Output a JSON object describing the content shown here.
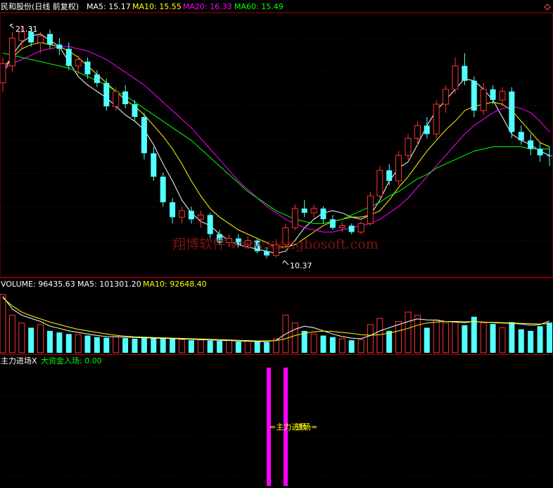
{
  "stock_name": "民和股份(日线 前复权)",
  "corner_icon": "diamond-icon",
  "watermark": "翔博软件 www.xiangbosoft.com",
  "price_panel": {
    "legend": [
      {
        "label": "MA5: 15.17",
        "color": "#ffffff"
      },
      {
        "label": "MA10: 15.55",
        "color": "#ffff00"
      },
      {
        "label": "MA20: 16.33",
        "color": "#ff00ff"
      },
      {
        "label": "MA60: 15.49",
        "color": "#00ff00"
      }
    ],
    "high_marker": "21.31",
    "low_marker": "10.37"
  },
  "volume_panel": {
    "legend": [
      {
        "label": "VOLUME: 96435.63",
        "color": "#ffffff"
      },
      {
        "label": "MA5: 101301.20",
        "color": "#ffffff"
      },
      {
        "label": "MA10: 92648.40",
        "color": "#ffff00"
      }
    ]
  },
  "signal_panel": {
    "legend": [
      {
        "label": "主力进场X",
        "color": "#ffffff"
      },
      {
        "label": "大资金入场: 0.00",
        "color": "#00ff00"
      }
    ],
    "annotations": [
      "=主力进场",
      "进场="
    ]
  },
  "colors": {
    "up": "#ff3232",
    "down": "#54ffff",
    "grid": "#7a0000",
    "border": "#b00000",
    "ma5": "#ffffff",
    "ma10": "#ffff00",
    "ma20": "#ff00ff",
    "ma60": "#00ff00",
    "signal": "#ff00ff",
    "signal_text": "#ffff00"
  },
  "chart_data": [
    {
      "type": "candlestick",
      "title": "民和股份(日线 前复权)",
      "ylim": [
        9.6,
        21.7
      ],
      "series": [
        {
          "name": "MA5",
          "values": [
            19.0,
            19.9,
            20.5,
            20.8,
            20.9,
            20.6,
            20.3,
            19.6,
            18.9,
            18.5,
            18.2,
            17.9,
            17.5,
            17.1,
            16.8,
            16.4,
            15.7,
            14.8,
            14.0,
            13.1,
            12.5,
            12.1,
            11.9,
            11.5,
            11.2,
            11.0,
            10.9,
            10.8,
            10.7,
            10.6,
            10.7,
            11.2,
            11.8,
            12.2,
            12.5,
            12.6,
            12.5,
            12.3,
            12.2,
            12.4,
            13.1,
            14.0,
            14.6,
            14.9,
            15.7,
            16.6,
            17.3,
            17.8,
            18.3,
            18.8,
            18.7,
            18.3,
            17.8,
            17.0,
            16.2,
            15.9,
            15.7,
            15.4,
            15.2
          ]
        },
        {
          "name": "MA10",
          "values": [
            19.3,
            19.8,
            20.2,
            20.4,
            20.5,
            20.4,
            20.3,
            20.1,
            19.8,
            19.4,
            19.0,
            18.6,
            18.2,
            17.8,
            17.5,
            17.1,
            16.6,
            16.1,
            15.5,
            14.8,
            14.0,
            13.3,
            12.7,
            12.3,
            12.0,
            11.7,
            11.5,
            11.3,
            11.1,
            10.9,
            10.9,
            11.0,
            11.3,
            11.6,
            11.9,
            12.1,
            12.2,
            12.3,
            12.3,
            12.4,
            12.6,
            13.1,
            13.7,
            14.2,
            14.8,
            15.4,
            15.9,
            16.4,
            16.8,
            17.3,
            17.5,
            17.6,
            17.7,
            17.6,
            17.3,
            16.8,
            16.3,
            15.8,
            15.6
          ]
        },
        {
          "name": "MA20",
          "values": [
            19.2,
            19.5,
            19.7,
            19.9,
            20.1,
            20.2,
            20.3,
            20.3,
            20.2,
            20.1,
            19.9,
            19.7,
            19.4,
            19.1,
            18.8,
            18.5,
            18.1,
            17.7,
            17.3,
            16.9,
            16.5,
            16.0,
            15.5,
            15.0,
            14.5,
            14.0,
            13.6,
            13.2,
            12.8,
            12.5,
            12.2,
            12.0,
            11.8,
            11.7,
            11.6,
            11.6,
            11.7,
            11.8,
            11.9,
            12.0,
            12.2,
            12.5,
            12.8,
            13.2,
            13.7,
            14.2,
            14.7,
            15.2,
            15.7,
            16.2,
            16.6,
            16.9,
            17.2,
            17.4,
            17.5,
            17.4,
            17.2,
            16.8,
            16.3
          ]
        },
        {
          "name": "MA60",
          "values": [
            20.0,
            19.9,
            19.8,
            19.7,
            19.6,
            19.5,
            19.4,
            19.3,
            19.1,
            18.9,
            18.7,
            18.5,
            18.2,
            18.0,
            17.7,
            17.4,
            17.1,
            16.8,
            16.5,
            16.2,
            15.9,
            15.5,
            15.1,
            14.7,
            14.3,
            13.9,
            13.5,
            13.2,
            12.9,
            12.6,
            12.4,
            12.2,
            12.1,
            12.0,
            12.0,
            12.1,
            12.2,
            12.4,
            12.6,
            12.8,
            13.0,
            13.3,
            13.5,
            13.8,
            14.1,
            14.3,
            14.6,
            14.8,
            15.0,
            15.2,
            15.4,
            15.5,
            15.6,
            15.6,
            15.6,
            15.6,
            15.5,
            15.5,
            15.5
          ]
        }
      ],
      "candles": [
        {
          "o": 18.6,
          "h": 19.8,
          "l": 18.2,
          "c": 19.5
        },
        {
          "o": 19.4,
          "h": 21.0,
          "l": 19.1,
          "c": 20.7
        },
        {
          "o": 20.6,
          "h": 21.3,
          "l": 20.2,
          "c": 21.0
        },
        {
          "o": 21.0,
          "h": 21.2,
          "l": 20.3,
          "c": 20.5
        },
        {
          "o": 20.5,
          "h": 21.0,
          "l": 20.0,
          "c": 20.8
        },
        {
          "o": 20.9,
          "h": 21.1,
          "l": 20.2,
          "c": 20.4
        },
        {
          "o": 20.4,
          "h": 20.7,
          "l": 19.9,
          "c": 20.2
        },
        {
          "o": 20.2,
          "h": 20.5,
          "l": 19.2,
          "c": 19.4
        },
        {
          "o": 19.4,
          "h": 19.9,
          "l": 19.0,
          "c": 19.7
        },
        {
          "o": 19.6,
          "h": 19.8,
          "l": 18.8,
          "c": 19.0
        },
        {
          "o": 19.0,
          "h": 19.2,
          "l": 18.4,
          "c": 18.6
        },
        {
          "o": 18.6,
          "h": 18.8,
          "l": 17.3,
          "c": 17.5
        },
        {
          "o": 17.5,
          "h": 18.4,
          "l": 17.3,
          "c": 18.2
        },
        {
          "o": 18.2,
          "h": 18.5,
          "l": 17.4,
          "c": 17.6
        },
        {
          "o": 17.6,
          "h": 17.8,
          "l": 16.8,
          "c": 17.0
        },
        {
          "o": 17.0,
          "h": 17.2,
          "l": 15.0,
          "c": 15.3
        },
        {
          "o": 15.3,
          "h": 15.6,
          "l": 14.0,
          "c": 14.2
        },
        {
          "o": 14.2,
          "h": 14.4,
          "l": 12.8,
          "c": 13.0
        },
        {
          "o": 13.0,
          "h": 13.2,
          "l": 12.0,
          "c": 12.3
        },
        {
          "o": 12.3,
          "h": 12.8,
          "l": 12.0,
          "c": 12.6
        },
        {
          "o": 12.6,
          "h": 12.8,
          "l": 12.0,
          "c": 12.2
        },
        {
          "o": 12.2,
          "h": 12.6,
          "l": 11.8,
          "c": 12.4
        },
        {
          "o": 12.4,
          "h": 12.5,
          "l": 11.3,
          "c": 11.5
        },
        {
          "o": 11.5,
          "h": 11.7,
          "l": 11.0,
          "c": 11.1
        },
        {
          "o": 11.1,
          "h": 11.5,
          "l": 10.9,
          "c": 11.3
        },
        {
          "o": 11.3,
          "h": 11.5,
          "l": 10.9,
          "c": 11.0
        },
        {
          "o": 11.0,
          "h": 11.4,
          "l": 10.8,
          "c": 11.2
        },
        {
          "o": 11.2,
          "h": 11.3,
          "l": 10.6,
          "c": 10.7
        },
        {
          "o": 10.7,
          "h": 10.9,
          "l": 10.37,
          "c": 10.5
        },
        {
          "o": 10.5,
          "h": 11.2,
          "l": 10.4,
          "c": 11.0
        },
        {
          "o": 11.0,
          "h": 12.0,
          "l": 10.9,
          "c": 11.8
        },
        {
          "o": 11.8,
          "h": 12.9,
          "l": 11.7,
          "c": 12.7
        },
        {
          "o": 12.7,
          "h": 13.1,
          "l": 12.3,
          "c": 12.5
        },
        {
          "o": 12.5,
          "h": 12.9,
          "l": 12.2,
          "c": 12.7
        },
        {
          "o": 12.7,
          "h": 12.8,
          "l": 12.0,
          "c": 12.2
        },
        {
          "o": 12.2,
          "h": 12.4,
          "l": 11.7,
          "c": 11.8
        },
        {
          "o": 11.8,
          "h": 12.1,
          "l": 11.6,
          "c": 11.9
        },
        {
          "o": 11.9,
          "h": 12.0,
          "l": 11.5,
          "c": 11.6
        },
        {
          "o": 11.6,
          "h": 12.1,
          "l": 11.5,
          "c": 12.0
        },
        {
          "o": 12.0,
          "h": 13.5,
          "l": 11.9,
          "c": 13.3
        },
        {
          "o": 13.3,
          "h": 14.7,
          "l": 13.2,
          "c": 14.5
        },
        {
          "o": 14.5,
          "h": 14.8,
          "l": 13.8,
          "c": 14.0
        },
        {
          "o": 14.0,
          "h": 15.4,
          "l": 13.8,
          "c": 15.2
        },
        {
          "o": 15.2,
          "h": 16.2,
          "l": 15.0,
          "c": 16.0
        },
        {
          "o": 16.0,
          "h": 16.8,
          "l": 15.7,
          "c": 16.6
        },
        {
          "o": 16.6,
          "h": 17.0,
          "l": 16.0,
          "c": 16.2
        },
        {
          "o": 16.2,
          "h": 17.8,
          "l": 16.0,
          "c": 17.6
        },
        {
          "o": 17.6,
          "h": 18.5,
          "l": 17.2,
          "c": 18.3
        },
        {
          "o": 18.3,
          "h": 19.8,
          "l": 18.1,
          "c": 19.4
        },
        {
          "o": 19.4,
          "h": 20.0,
          "l": 18.5,
          "c": 18.7
        },
        {
          "o": 18.7,
          "h": 18.9,
          "l": 17.0,
          "c": 17.3
        },
        {
          "o": 17.3,
          "h": 18.6,
          "l": 17.1,
          "c": 18.3
        },
        {
          "o": 18.3,
          "h": 18.5,
          "l": 17.6,
          "c": 17.8
        },
        {
          "o": 17.8,
          "h": 18.4,
          "l": 17.5,
          "c": 18.2
        },
        {
          "o": 18.2,
          "h": 18.4,
          "l": 16.0,
          "c": 16.3
        },
        {
          "o": 16.3,
          "h": 16.6,
          "l": 15.7,
          "c": 15.9
        },
        {
          "o": 15.9,
          "h": 16.2,
          "l": 15.2,
          "c": 15.5
        },
        {
          "o": 15.5,
          "h": 15.8,
          "l": 14.9,
          "c": 15.2
        },
        {
          "o": 15.2,
          "h": 15.6,
          "l": 14.7,
          "c": 15.17
        }
      ]
    },
    {
      "type": "bar",
      "title": "VOLUME",
      "ylim": [
        0,
        200000
      ],
      "values": [
        186000,
        120000,
        95000,
        80000,
        90000,
        70000,
        65000,
        60000,
        58000,
        55000,
        50000,
        48000,
        52000,
        47000,
        45000,
        50000,
        48000,
        46000,
        44000,
        42000,
        40000,
        41000,
        39000,
        38000,
        40000,
        36000,
        37000,
        35000,
        34000,
        45000,
        120000,
        95000,
        70000,
        60000,
        55000,
        50000,
        45000,
        40000,
        42000,
        90000,
        110000,
        70000,
        100000,
        130000,
        120000,
        80000,
        105000,
        95000,
        100000,
        88000,
        115000,
        95000,
        92000,
        80000,
        98000,
        75000,
        70000,
        85000,
        96435
      ],
      "up": [
        true,
        true,
        true,
        false,
        true,
        false,
        false,
        false,
        true,
        false,
        false,
        false,
        true,
        false,
        false,
        false,
        false,
        false,
        false,
        true,
        false,
        true,
        false,
        false,
        true,
        false,
        true,
        false,
        false,
        true,
        true,
        true,
        false,
        true,
        false,
        false,
        true,
        false,
        true,
        true,
        true,
        false,
        true,
        true,
        true,
        false,
        true,
        true,
        true,
        false,
        false,
        true,
        false,
        true,
        false,
        false,
        false,
        false,
        false
      ],
      "series": [
        {
          "name": "MA5",
          "values": [
            180000,
            140000,
            120000,
            110000,
            100000,
            85000,
            78000,
            70000,
            65000,
            60000,
            55000,
            52000,
            51000,
            50000,
            49000,
            48000,
            47000,
            46000,
            45000,
            44000,
            43000,
            42000,
            41000,
            40000,
            39000,
            38000,
            37000,
            36000,
            36000,
            40000,
            60000,
            75000,
            85000,
            80000,
            70000,
            60000,
            52000,
            47000,
            45000,
            55000,
            70000,
            80000,
            90000,
            100000,
            108000,
            105000,
            104000,
            100000,
            98000,
            96000,
            100000,
            98000,
            96000,
            95000,
            94000,
            92000,
            88000,
            90000,
            101301
          ]
        },
        {
          "name": "MA10",
          "values": [
            175000,
            150000,
            130000,
            118000,
            108000,
            98000,
            90000,
            82000,
            75000,
            70000,
            65000,
            60000,
            56000,
            53000,
            51000,
            50000,
            49000,
            48000,
            47000,
            46000,
            45000,
            44000,
            43000,
            42000,
            41000,
            40000,
            39000,
            38000,
            38000,
            39000,
            45000,
            55000,
            62000,
            67000,
            69000,
            68000,
            65000,
            62000,
            58000,
            56000,
            58000,
            63000,
            70000,
            78000,
            88000,
            95000,
            98000,
            100000,
            100000,
            99000,
            99000,
            98000,
            97000,
            96000,
            95000,
            94000,
            93000,
            92000,
            92648
          ]
        }
      ]
    },
    {
      "type": "bar",
      "title": "主力进场X",
      "signals": [
        {
          "index": 28,
          "value": 1
        },
        {
          "index": 30,
          "value": 1
        }
      ]
    }
  ]
}
